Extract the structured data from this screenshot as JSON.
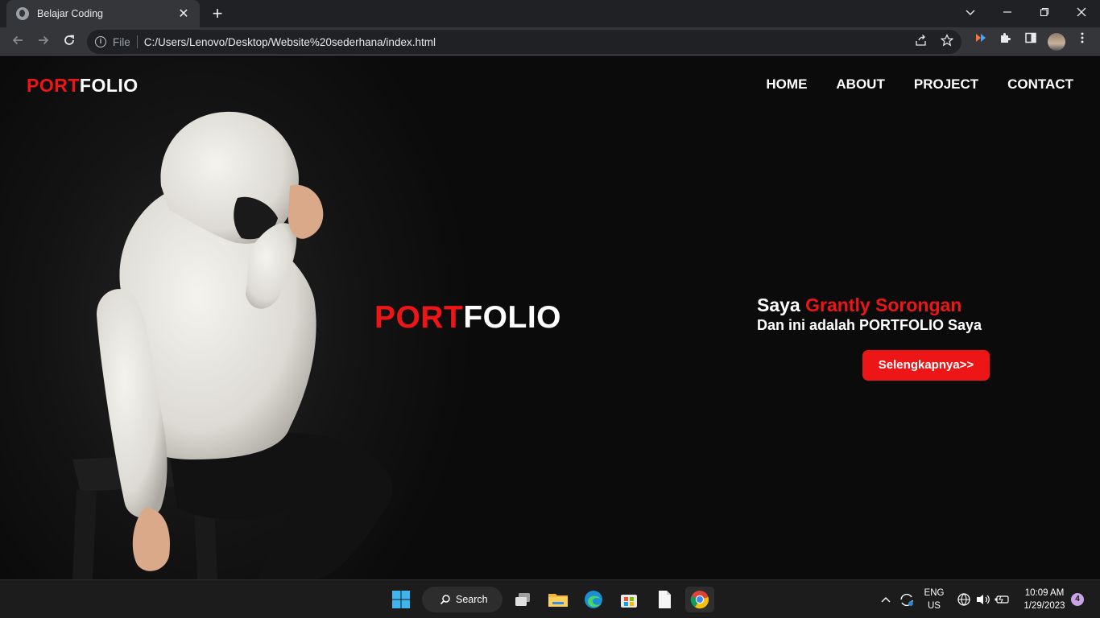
{
  "browser": {
    "tab_title": "Belajar Coding",
    "tab_close": "✕",
    "new_tab": "+",
    "scheme_label": "File",
    "url": "C:/Users/Lenovo/Desktop/Website%20sederhana/index.html"
  },
  "site": {
    "logo_red": "PORT",
    "logo_white": "FOLIO",
    "nav": [
      "HOME",
      "ABOUT",
      "PROJECT",
      "CONTACT"
    ],
    "hero_red": "PORT",
    "hero_white": "FOLIO",
    "intro_prefix": "Saya ",
    "intro_name": "Grantly Sorongan",
    "intro_line2": "Dan ini adalah PORTFOLIO Saya",
    "cta_label": "Selengkapnya>>",
    "accent_color": "#ed1515"
  },
  "taskbar": {
    "search_label": "Search",
    "lang_line1": "ENG",
    "lang_line2": "US",
    "time": "10:09 AM",
    "date": "1/29/2023",
    "notification_count": "4"
  }
}
